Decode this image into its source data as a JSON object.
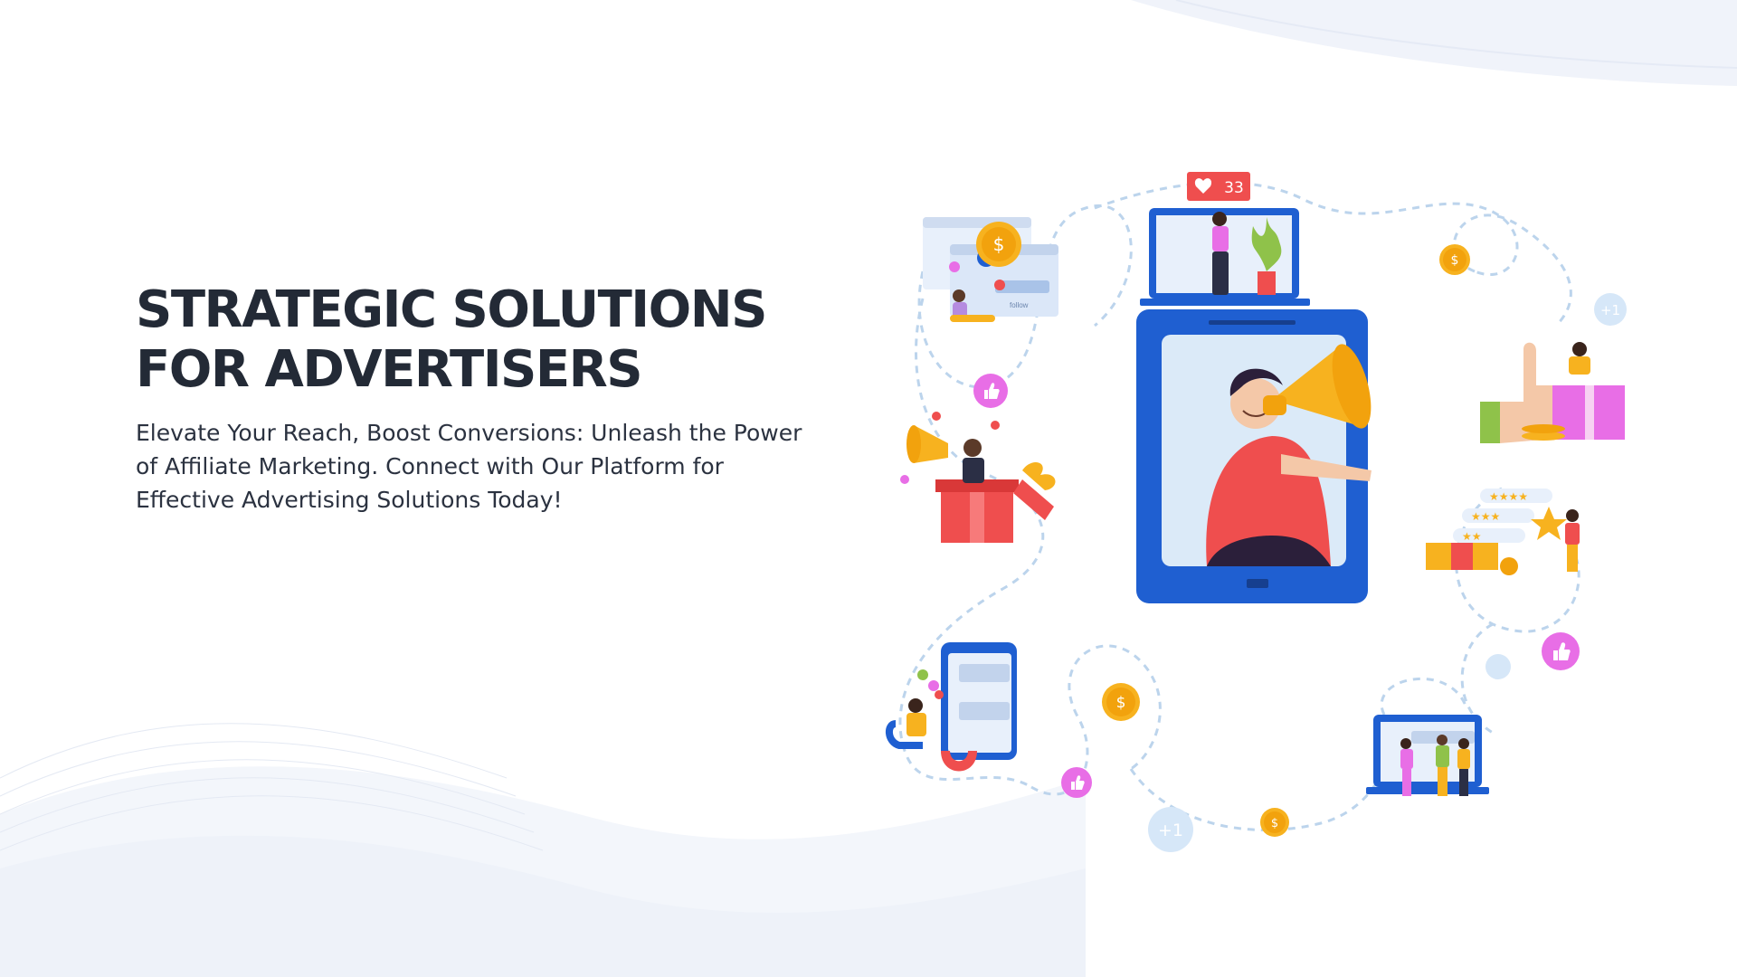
{
  "hero": {
    "title_line1": "STRATEGIC  SOLUTIONS",
    "title_line2": "FOR ADVERTISERS",
    "subtitle": "Elevate Your Reach, Boost Conversions: Unleash the Power of Affiliate Marketing. Connect with Our Platform for Effective Advertising Solutions Today!"
  },
  "illustration": {
    "like_badge_count": "33",
    "plus_one_label": "+1",
    "dollar_symbol": "$",
    "follow_label": "follow"
  },
  "colors": {
    "title": "#232a36",
    "tablet_blue": "#1f5fd1",
    "megaphone_yellow": "#f7b21f",
    "shirt_red": "#ef4e4e",
    "like_pink": "#e86ee6",
    "dashed_path": "#bcd4ec"
  }
}
